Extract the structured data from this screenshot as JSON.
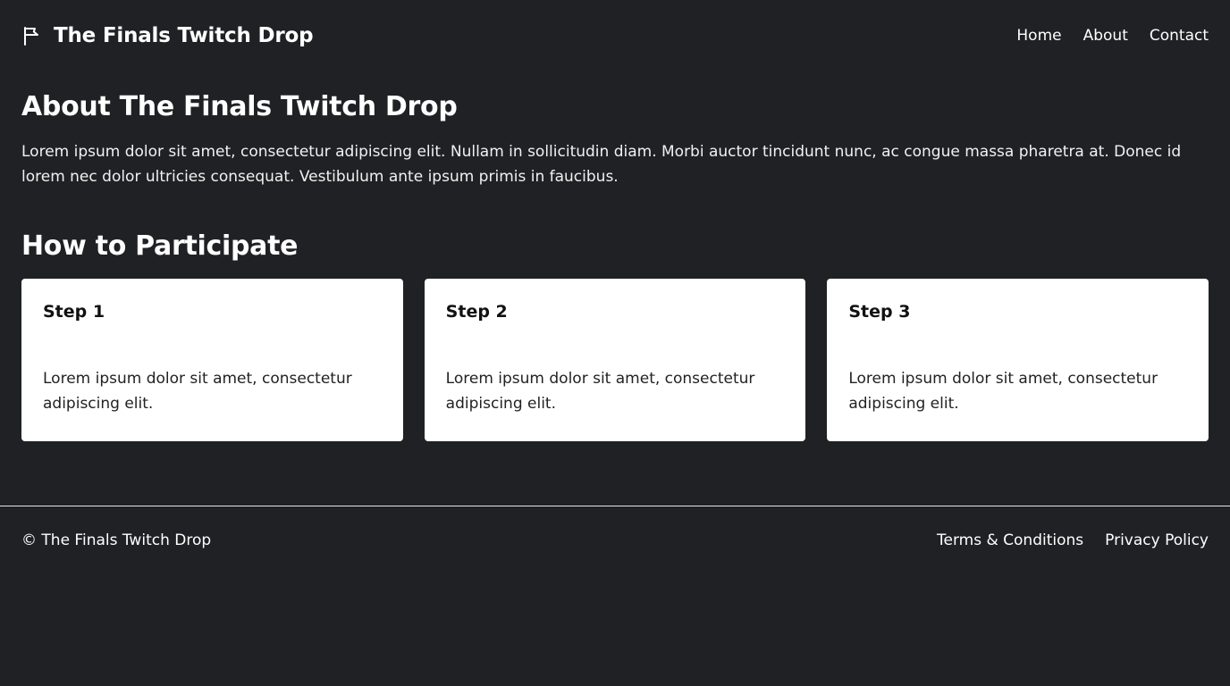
{
  "header": {
    "brand_icon": "flag-icon",
    "title": "The Finals Twitch Drop",
    "nav": [
      "Home",
      "About",
      "Contact"
    ]
  },
  "about": {
    "heading": "About The Finals Twitch Drop",
    "text": "Lorem ipsum dolor sit amet, consectetur adipiscing elit. Nullam in sollicitudin diam. Morbi auctor tincidunt nunc, ac congue massa pharetra at. Donec id lorem nec dolor ultricies consequat. Vestibulum ante ipsum primis in faucibus."
  },
  "participate": {
    "heading": "How to Participate",
    "steps": [
      {
        "title": "Step 1",
        "text": "Lorem ipsum dolor sit amet, consectetur adipiscing elit."
      },
      {
        "title": "Step 2",
        "text": "Lorem ipsum dolor sit amet, consectetur adipiscing elit."
      },
      {
        "title": "Step 3",
        "text": "Lorem ipsum dolor sit amet, consectetur adipiscing elit."
      }
    ]
  },
  "footer": {
    "copyright": "© The Finals Twitch Drop",
    "links": [
      "Terms & Conditions",
      "Privacy Policy"
    ]
  },
  "colors": {
    "background": "#202124",
    "card": "#ffffff",
    "text": "#ffffff"
  }
}
